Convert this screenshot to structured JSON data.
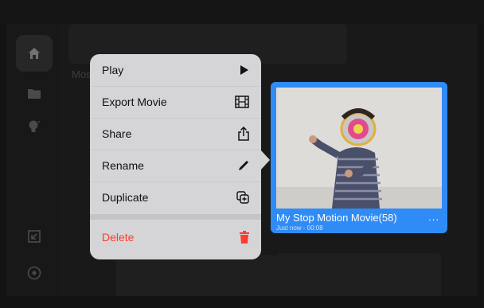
{
  "background": {
    "partial_title": "Mos"
  },
  "sidebar": {
    "items": [
      {
        "icon": "home-icon",
        "active": true
      },
      {
        "icon": "folder-icon",
        "active": false
      },
      {
        "icon": "lightbulb-icon",
        "active": false
      },
      {
        "icon": "import-icon",
        "active": false
      },
      {
        "icon": "settings-icon",
        "active": false
      }
    ]
  },
  "context_menu": {
    "items": [
      {
        "label": "Play",
        "icon": "play-icon"
      },
      {
        "label": "Export Movie",
        "icon": "film-icon"
      },
      {
        "label": "Share",
        "icon": "share-icon"
      },
      {
        "label": "Rename",
        "icon": "pencil-icon"
      },
      {
        "label": "Duplicate",
        "icon": "duplicate-icon"
      }
    ],
    "delete": {
      "label": "Delete",
      "icon": "trash-icon",
      "color": "#ff3b30"
    }
  },
  "selected_movie": {
    "title": "My Stop Motion Movie(58)",
    "subtitle": "Just now - 00:08",
    "more_label": "...",
    "accent": "#2f8bf5"
  }
}
